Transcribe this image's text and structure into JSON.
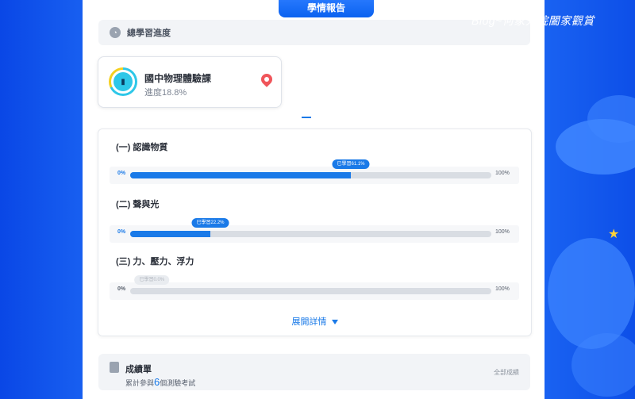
{
  "header": {
    "tab_label": "學情報告",
    "watermark": "Blog~何家大院闔家觀賞"
  },
  "overall": {
    "section_title": "總學習進度"
  },
  "course": {
    "title": "國中物理體驗課",
    "progress_text": "進度18.8%",
    "progress": 0.188
  },
  "units": [
    {
      "title": "(一) 認識物質",
      "left_label": "0%",
      "right_label": "100%",
      "bubble": "已學習61.1%",
      "progress": 0.611
    },
    {
      "title": "(二) 聲與光",
      "left_label": "0%",
      "right_label": "100%",
      "bubble": "已學習22.2%",
      "progress": 0.222
    },
    {
      "title": "(三) 力、壓力、浮力",
      "left_label": "0%",
      "right_label": "100%",
      "bubble": "已學習0.0%",
      "progress": 0.0
    }
  ],
  "expand_label": "展開詳情",
  "grades": {
    "title": "成績單",
    "sub_prefix": "累計參與",
    "count": "6",
    "sub_suffix": "個測驗考試",
    "link": "全部成績"
  },
  "colors": {
    "accent": "#1a7ae8",
    "background": "#1a63f2",
    "pin": "#f0555a"
  }
}
